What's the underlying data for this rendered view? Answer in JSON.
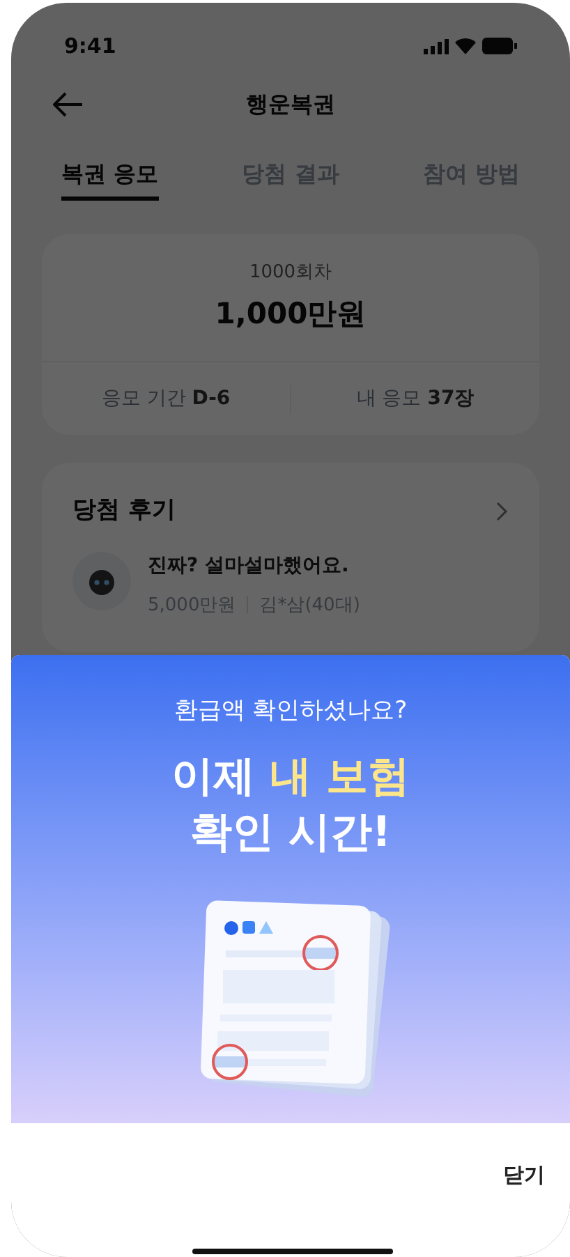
{
  "status_bar": {
    "time": "9:41"
  },
  "header": {
    "title": "행운복권"
  },
  "tabs": [
    {
      "label": "복권 응모",
      "selected": true
    },
    {
      "label": "당첨 결과",
      "selected": false
    },
    {
      "label": "참여 방법",
      "selected": false
    }
  ],
  "prize_card": {
    "round": "1000회차",
    "amount": "1,000만원",
    "stats": [
      "응모 기간 **D-6**",
      "내 응모 **37장**"
    ]
  },
  "reviews": {
    "title": "당첨 후기",
    "items": [
      {
        "text": "진짜? 설마설마했어요.",
        "prize": "5,000만원",
        "author": "김*삼(40대)"
      }
    ]
  },
  "sheet": {
    "subtitle": "환급액 확인하셨나요?",
    "headline": [
      "이제 **내 보험**",
      "확인 시간!"
    ],
    "close": "닫기"
  }
}
